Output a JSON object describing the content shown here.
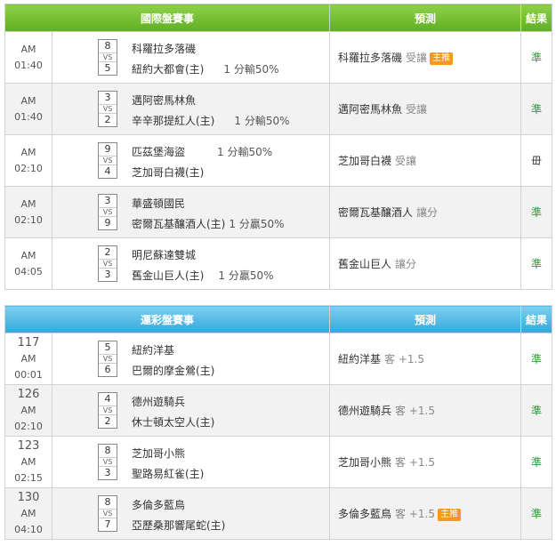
{
  "intl": {
    "header": {
      "event": "國際盤賽事",
      "predict": "預測",
      "result": "結果"
    },
    "rows": [
      {
        "time": "AM 01:40",
        "score1": "8",
        "vs": "VS",
        "score2": "5",
        "team1": "科羅拉多落磯",
        "team2": "紐約大都會(主)",
        "odds1": "",
        "odds2": "1 分輸50%",
        "pred_team": "科羅拉多落磯",
        "pred_sub": "受讓",
        "badge": "主推",
        "result": "準",
        "result_status": "win"
      },
      {
        "time": "AM 01:40",
        "score1": "3",
        "vs": "VS",
        "score2": "2",
        "team1": "邁阿密馬林魚",
        "team2": "辛辛那提紅人(主)",
        "odds1": "",
        "odds2": "1 分輸50%",
        "pred_team": "邁阿密馬林魚",
        "pred_sub": "受讓",
        "badge": "",
        "result": "準",
        "result_status": "win"
      },
      {
        "time": "AM 02:10",
        "score1": "9",
        "vs": "VS",
        "score2": "4",
        "team1": "匹茲堡海盜",
        "team2": "芝加哥白襪(主)",
        "odds1": "1 分輸50%",
        "odds2": "",
        "pred_team": "芝加哥白襪",
        "pred_sub": "受讓",
        "badge": "",
        "result": "毌",
        "result_status": "lose"
      },
      {
        "time": "AM 02:10",
        "score1": "3",
        "vs": "VS",
        "score2": "9",
        "team1": "華盛頓國民",
        "team2": "密爾瓦基釀酒人(主)",
        "odds1": "",
        "odds2": "1 分贏50%",
        "pred_team": "密爾瓦基釀酒人",
        "pred_sub": "讓分",
        "badge": "",
        "result": "準",
        "result_status": "win"
      },
      {
        "time": "AM 04:05",
        "score1": "2",
        "vs": "VS",
        "score2": "3",
        "team1": "明尼蘇達雙城",
        "team2": "舊金山巨人(主)",
        "odds1": "",
        "odds2": "1 分贏50%",
        "pred_team": "舊金山巨人",
        "pred_sub": "讓分",
        "badge": "",
        "result": "準",
        "result_status": "win"
      }
    ]
  },
  "lottery": {
    "header": {
      "event": "運彩盤賽事",
      "predict": "預測",
      "result": "結果"
    },
    "rows": [
      {
        "num": "117",
        "time": "AM 00:01",
        "score1": "5",
        "vs": "VS",
        "score2": "6",
        "team1": "紐約洋基",
        "team2": "巴爾的摩金鶯(主)",
        "pred_team": "紐約洋基",
        "pred_sub": "客 +1.5",
        "badge": "",
        "result": "準",
        "result_status": "win"
      },
      {
        "num": "126",
        "time": "AM 02:10",
        "score1": "4",
        "vs": "VS",
        "score2": "2",
        "team1": "德州遊騎兵",
        "team2": "休士頓太空人(主)",
        "pred_team": "德州遊騎兵",
        "pred_sub": "客 +1.5",
        "badge": "",
        "result": "準",
        "result_status": "win"
      },
      {
        "num": "123",
        "time": "AM 02:15",
        "score1": "8",
        "vs": "VS",
        "score2": "3",
        "team1": "芝加哥小熊",
        "team2": "聖路易紅雀(主)",
        "pred_team": "芝加哥小熊",
        "pred_sub": "客 +1.5",
        "badge": "",
        "result": "準",
        "result_status": "win"
      },
      {
        "num": "130",
        "time": "AM 04:10",
        "score1": "8",
        "vs": "VS",
        "score2": "7",
        "team1": "多倫多藍鳥",
        "team2": "亞歷桑那響尾蛇(主)",
        "pred_team": "多倫多藍鳥",
        "pred_sub": "客 +1.5",
        "badge": "主推",
        "result": "準",
        "result_status": "win"
      }
    ]
  }
}
